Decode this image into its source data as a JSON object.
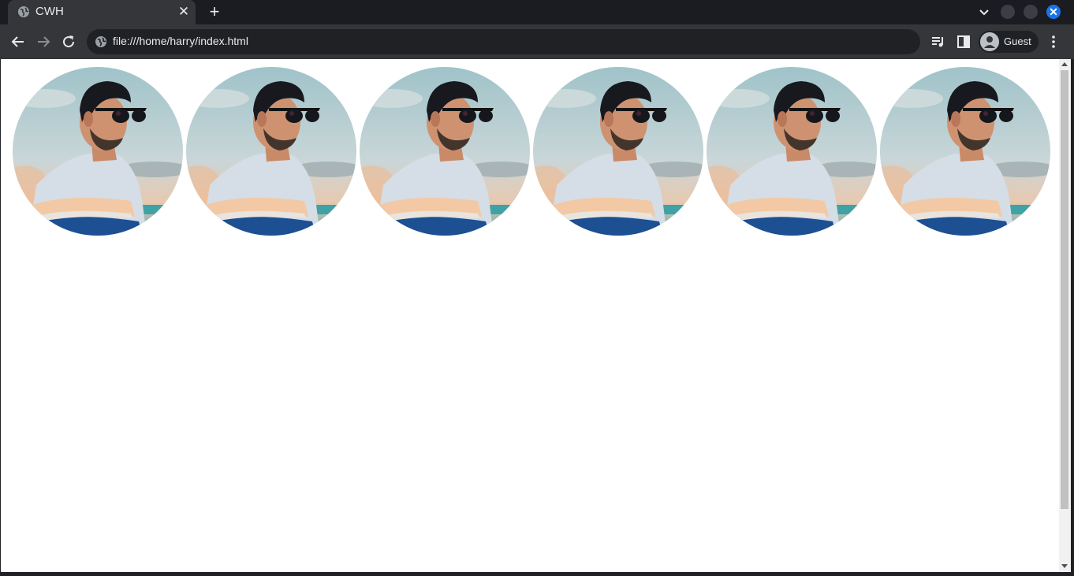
{
  "browser": {
    "tab": {
      "title": "CWH",
      "close_glyph": "✕"
    },
    "new_tab_glyph": "+",
    "address": {
      "url": "file:///home/harry/index.html"
    },
    "profile": {
      "label": "Guest"
    },
    "window": {
      "close_glyph": "✕"
    }
  },
  "page": {
    "images": [
      {
        "name": "profile-photo-1"
      },
      {
        "name": "profile-photo-2"
      },
      {
        "name": "profile-photo-3"
      },
      {
        "name": "profile-photo-4"
      },
      {
        "name": "profile-photo-5"
      },
      {
        "name": "profile-photo-6"
      }
    ]
  },
  "colors": {
    "chrome_dark": "#202124",
    "chrome_toolbar": "#35363a",
    "accent": "#1a73e8",
    "page_bg": "#ffffff"
  }
}
